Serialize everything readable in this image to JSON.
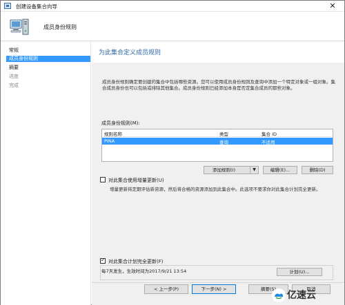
{
  "window": {
    "title": "创建设备集合向导",
    "close_glyph": "✕"
  },
  "header": {
    "title": "成员身份规则"
  },
  "sidebar": {
    "items": [
      {
        "label": "常规",
        "state": "normal"
      },
      {
        "label": "成员身份规则",
        "state": "active"
      },
      {
        "label": "摘要",
        "state": "normal"
      },
      {
        "label": "进度",
        "state": "dim"
      },
      {
        "label": "完成",
        "state": "dim"
      }
    ]
  },
  "main": {
    "page_title": "为此集合定义成员规则",
    "description": "成员身份规则确定要创建的集合中包括哪些资源。您可以使用成员身份规则及查询中添加一个特定对象或一组对象。集合成员身份也可以包括或排除其他集合。成员身份规则已经添加本身是否定集合成员的那些对象。",
    "rules_label": "成员身份规则(M):",
    "columns": [
      "规则名称",
      "类型",
      "集合 ID"
    ],
    "rows": [
      {
        "name": "PINA",
        "type": "查询",
        "collection_id": "不适用"
      }
    ],
    "buttons": {
      "add_rule": "添加规则(I)",
      "add_rule_arrow": "▼",
      "edit": "编辑(E)...",
      "delete": "删除(D)"
    },
    "incremental_checkbox": {
      "label": "对此集合使用增量更新(U)",
      "checked": false
    },
    "incremental_description": "增量更新将定期评估新资源，然后将合格的资源添加到此集合中。此选项不要求你对此集合计划完全更新。",
    "schedule_checkbox": {
      "label": "对此集合计划完全更新(F)",
      "checked": true
    },
    "schedule_text": "每7天发生，生效时间为2017/9/21 13:54",
    "schedule_button": "计划(U)..."
  },
  "footer": {
    "prev": "< 上一步(P)",
    "next": "下一步(N) >",
    "summary": "摘要(S)",
    "cancel": "取消"
  },
  "watermark": {
    "text": "亿速云"
  },
  "colors": {
    "accent": "#3399ff",
    "title_blue": "#2f69a8",
    "panel_bg": "#f0f0f0"
  }
}
